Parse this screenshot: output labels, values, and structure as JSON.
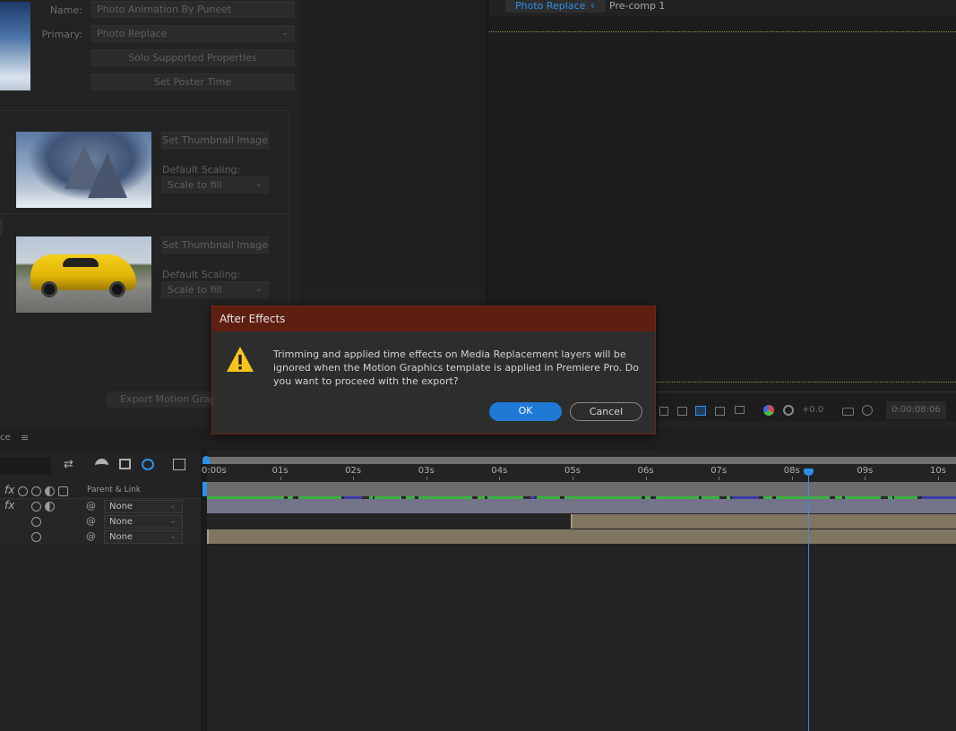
{
  "left_panel": {
    "name_label": "Name:",
    "name_value": "Photo Animation By Puneet",
    "primary_label": "Primary:",
    "primary_value": "Photo Replace",
    "solo_btn": "Solo Supported Properties",
    "poster_btn": "Set Poster Time",
    "media_items": [
      {
        "thumb_btn": "Set Thumbnail Image",
        "scaling_label": "Default Scaling:",
        "scaling_value": "Scale to fill"
      },
      {
        "thumb_btn": "Set Thumbnail Image",
        "scaling_label": "Default Scaling:",
        "scaling_value": "Scale to fill"
      }
    ],
    "export_btn": "Export Motion Graphi"
  },
  "comp": {
    "tab_active": "Photo Replace",
    "tab_next": "Pre-comp 1",
    "exposure": "+0.0",
    "timecode": "0:00:08:06"
  },
  "timeline": {
    "panel_tab": "ce",
    "parent_header": "Parent & Link",
    "ruler": [
      "0:00s",
      "01s",
      "02s",
      "03s",
      "04s",
      "05s",
      "06s",
      "07s",
      "08s",
      "09s",
      "10s"
    ],
    "rows": [
      {
        "parent": "None"
      },
      {
        "parent": "None"
      },
      {
        "parent": "None"
      }
    ],
    "playhead_seconds": 8.25
  },
  "dialog": {
    "title": "After Effects",
    "message": "Trimming and applied time effects on Media Replacement layers will be ignored when the Motion Graphics template is applied in Premiere Pro. Do you want to proceed with the export?",
    "ok_label": "OK",
    "cancel_label": "Cancel",
    "warning_color": "#f7c51a",
    "accent_color": "#1f7ad6"
  }
}
